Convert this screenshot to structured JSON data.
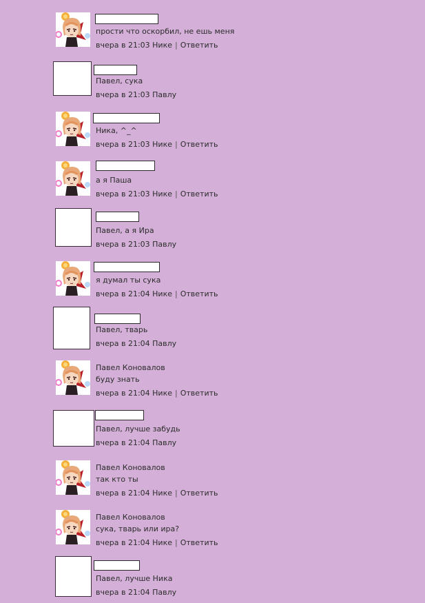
{
  "colors": {
    "background": "#d4b0d8",
    "text": "#2b2b2b"
  },
  "comments": [
    {
      "author": "",
      "text": "прости что оскорбил, не ешь меня",
      "time": "вчера в 21:03",
      "reply_to": "Нике",
      "reply": "Ответить",
      "avatar": "anime-avatar-icon"
    },
    {
      "author": "",
      "text": "Павел, сука",
      "time": "вчера в 21:03",
      "reply_to": "Павлу",
      "reply": "",
      "avatar": "blank-avatar"
    },
    {
      "author": "",
      "text": "Ника, ^_^",
      "time": "вчера в 21:03",
      "reply_to": "Нике",
      "reply": "Ответить",
      "avatar": "anime-avatar-icon"
    },
    {
      "author": "",
      "text": "а я Паша",
      "time": "вчера в 21:03",
      "reply_to": "Нике",
      "reply": "Ответить",
      "avatar": "anime-avatar-icon"
    },
    {
      "author": "",
      "text": "Павел, а я Ира",
      "time": "вчера в 21:03",
      "reply_to": "Павлу",
      "reply": "",
      "avatar": "blank-avatar"
    },
    {
      "author": "",
      "text": "я думал ты сука",
      "time": "вчера в 21:04",
      "reply_to": "Нике",
      "reply": "Ответить",
      "avatar": "anime-avatar-icon"
    },
    {
      "author": "",
      "text": "Павел, тварь",
      "time": "вчера в 21:04",
      "reply_to": "Павлу",
      "reply": "",
      "avatar": "blank-avatar"
    },
    {
      "author": "Павел Коновалов",
      "text": "буду знать",
      "time": "вчера в 21:04",
      "reply_to": "Нике",
      "reply": "Ответить",
      "avatar": "anime-avatar-icon"
    },
    {
      "author": "",
      "text": "Павел, лучше забудь",
      "time": "вчера в 21:04",
      "reply_to": "Павлу",
      "reply": "",
      "avatar": "blank-avatar"
    },
    {
      "author": "Павел Коновалов",
      "text": "так кто ты",
      "time": "вчера в 21:04",
      "reply_to": "Нике",
      "reply": "Ответить",
      "avatar": "anime-avatar-icon"
    },
    {
      "author": "Павел Коновалов",
      "text": "сука, тварь или ира?",
      "time": "вчера в 21:04",
      "reply_to": "Нике",
      "reply": "Ответить",
      "avatar": "anime-avatar-icon"
    },
    {
      "author": "",
      "text": "Павел, лучше Ника",
      "time": "вчера в 21:04",
      "reply_to": "Павлу",
      "reply": "",
      "avatar": "blank-avatar"
    }
  ]
}
